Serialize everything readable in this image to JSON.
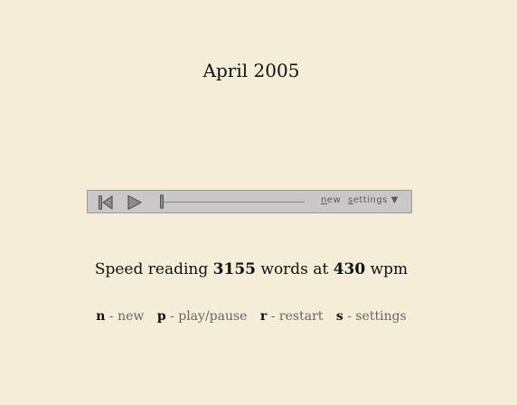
{
  "reader": {
    "current_word": "April 2005"
  },
  "player": {
    "progress": 0,
    "new_label": "new",
    "settings_label": "settings",
    "dropdown_arrow": "▼",
    "colors": {
      "background": "#c9c7ca",
      "border": "#9a989b",
      "icon": "#555555"
    },
    "icons": [
      "skip-to-start-icon",
      "play-icon"
    ]
  },
  "status": {
    "prefix": "Speed reading",
    "word_count": "3155",
    "middle": "words at",
    "wpm": "430",
    "suffix": "wpm"
  },
  "shortcuts": [
    {
      "key": "n",
      "desc": "- new"
    },
    {
      "key": "p",
      "desc": "- play/pause"
    },
    {
      "key": "r",
      "desc": "- restart"
    },
    {
      "key": "s",
      "desc": "- settings"
    }
  ],
  "page": {
    "background": "#f4edd8"
  }
}
